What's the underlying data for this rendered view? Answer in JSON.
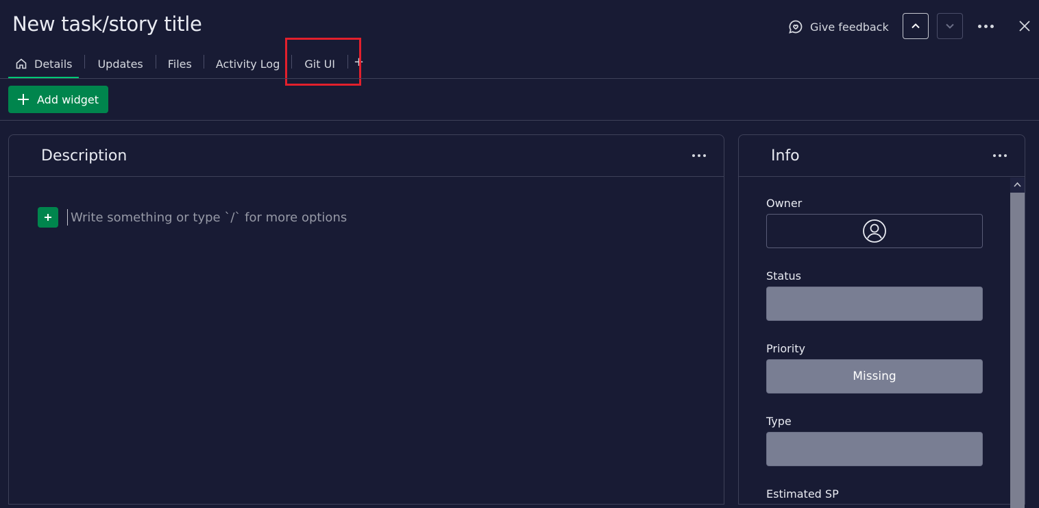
{
  "header": {
    "title": "New task/story title",
    "feedback_label": "Give feedback"
  },
  "tabs": [
    {
      "label": "Details",
      "icon": "home-icon",
      "active": true
    },
    {
      "label": "Updates"
    },
    {
      "label": "Files"
    },
    {
      "label": "Activity Log"
    },
    {
      "label": "Git UI",
      "highlighted": true
    }
  ],
  "add_tab": "+",
  "toolbar": {
    "add_widget_label": "Add widget"
  },
  "description": {
    "title": "Description",
    "placeholder": "Write something or type `/` for more options"
  },
  "info": {
    "title": "Info",
    "fields": [
      {
        "label": "Owner",
        "value": ""
      },
      {
        "label": "Status",
        "value": ""
      },
      {
        "label": "Priority",
        "value": "Missing"
      },
      {
        "label": "Type",
        "value": ""
      },
      {
        "label": "Estimated SP",
        "value": ""
      }
    ]
  },
  "colors": {
    "background": "#181b34",
    "accent_green": "#00854d",
    "active_tab_underline": "#00c875",
    "highlight_red": "#e2202c",
    "field_grey": "#797e93"
  }
}
